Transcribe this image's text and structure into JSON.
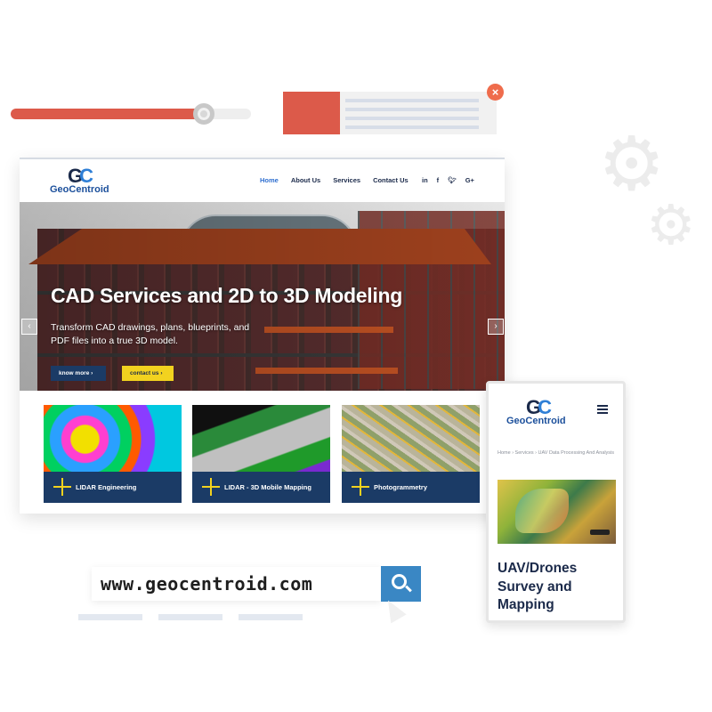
{
  "nav": {
    "brand": "GeoCentroid",
    "links": [
      "Home",
      "About Us",
      "Services",
      "Contact Us"
    ],
    "active_link": "Home",
    "social_icons": [
      "in",
      "f",
      "t",
      "G+"
    ]
  },
  "hero": {
    "title": "CAD Services and 2D to 3D Modeling",
    "subtitle": "Transform CAD drawings, plans, blueprints, and PDF files into a true 3D model.",
    "know_more_label": "know more",
    "contact_label": "contact us",
    "prev_icon": "chevron-left-icon",
    "next_icon": "chevron-right-icon"
  },
  "services": [
    {
      "label": "LIDAR Engineering"
    },
    {
      "label": "LIDAR - 3D Mobile Mapping"
    },
    {
      "label": "Photogrammetry"
    }
  ],
  "mobile": {
    "brand": "GeoCentroid",
    "breadcrumb": [
      "Home",
      "Services",
      "UAV Data Processing And Analysis"
    ],
    "breadcrumb_text": "Home  ›  Services  ›  UAV Data Processing And Analysis",
    "page_title": "UAV/Drones Survey and Mapping"
  },
  "url_bar": {
    "url": "www.geocentroid.com"
  },
  "slider": {
    "value": 0.77
  },
  "colors": {
    "accent": "#dc5a4a",
    "navy": "#1b3b66",
    "yellow": "#f2d21f",
    "link_active": "#2f6fd0",
    "search_blue": "#3a87c4"
  }
}
